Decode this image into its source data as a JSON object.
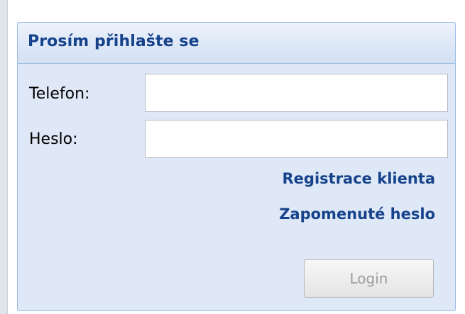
{
  "panel": {
    "title": "Prosím přihlašte se"
  },
  "form": {
    "phone": {
      "label": "Telefon:",
      "value": "",
      "placeholder": ""
    },
    "password": {
      "label": "Heslo:",
      "value": "",
      "placeholder": ""
    }
  },
  "links": {
    "register": "Registrace klienta",
    "forgot_password": "Zapomenuté heslo"
  },
  "actions": {
    "login_label": "Login",
    "login_enabled": false
  },
  "colors": {
    "panel_bg": "#dfe8f6",
    "panel_border": "#99bbe8",
    "title_text": "#15428b",
    "link_text": "#15428b",
    "disabled_text": "#9c9c9c"
  }
}
